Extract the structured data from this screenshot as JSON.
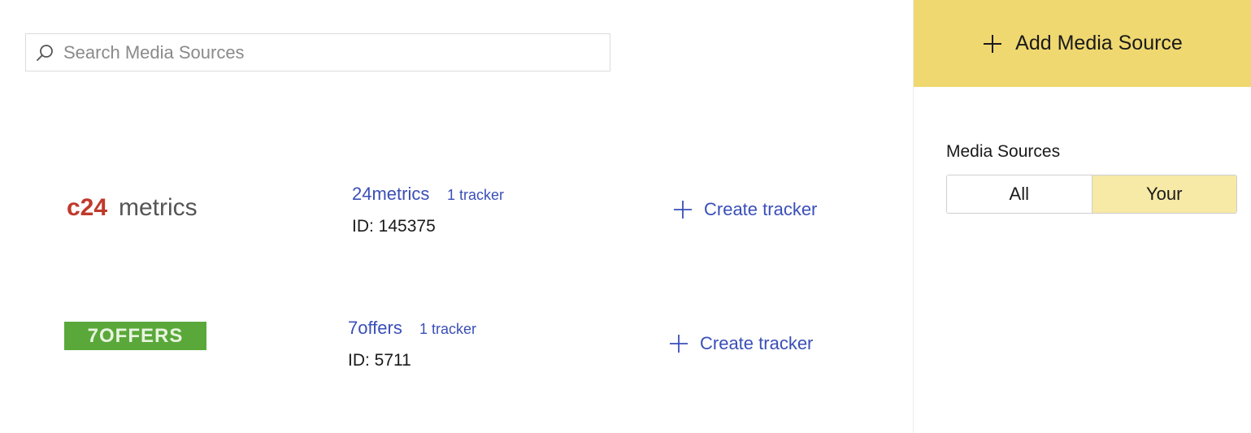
{
  "search": {
    "placeholder": "Search Media Sources",
    "value": ""
  },
  "sources": [
    {
      "logo_text": "24metrics",
      "name": "24metrics",
      "trackers": "1 tracker",
      "id": "ID: 145375",
      "create_label": "Create tracker"
    },
    {
      "logo_text": "7OFFERS",
      "name": "7offers",
      "trackers": "1 tracker",
      "id": "ID: 5711",
      "create_label": "Create tracker"
    }
  ],
  "sidebar": {
    "add_button_label": "Add Media Source",
    "filter_label": "Media Sources",
    "filter_options": [
      "All",
      "Your"
    ],
    "filter_selected": "Your"
  },
  "colors": {
    "link": "#3a4fb8",
    "add_button_bg": "#efd870",
    "selected_toggle_bg": "#f7e9a6",
    "logo_24metrics_red": "#c0392b",
    "logo_7offers_green": "#5aa83a"
  },
  "icons": {
    "search": "search-icon",
    "plus": "plus-icon"
  }
}
